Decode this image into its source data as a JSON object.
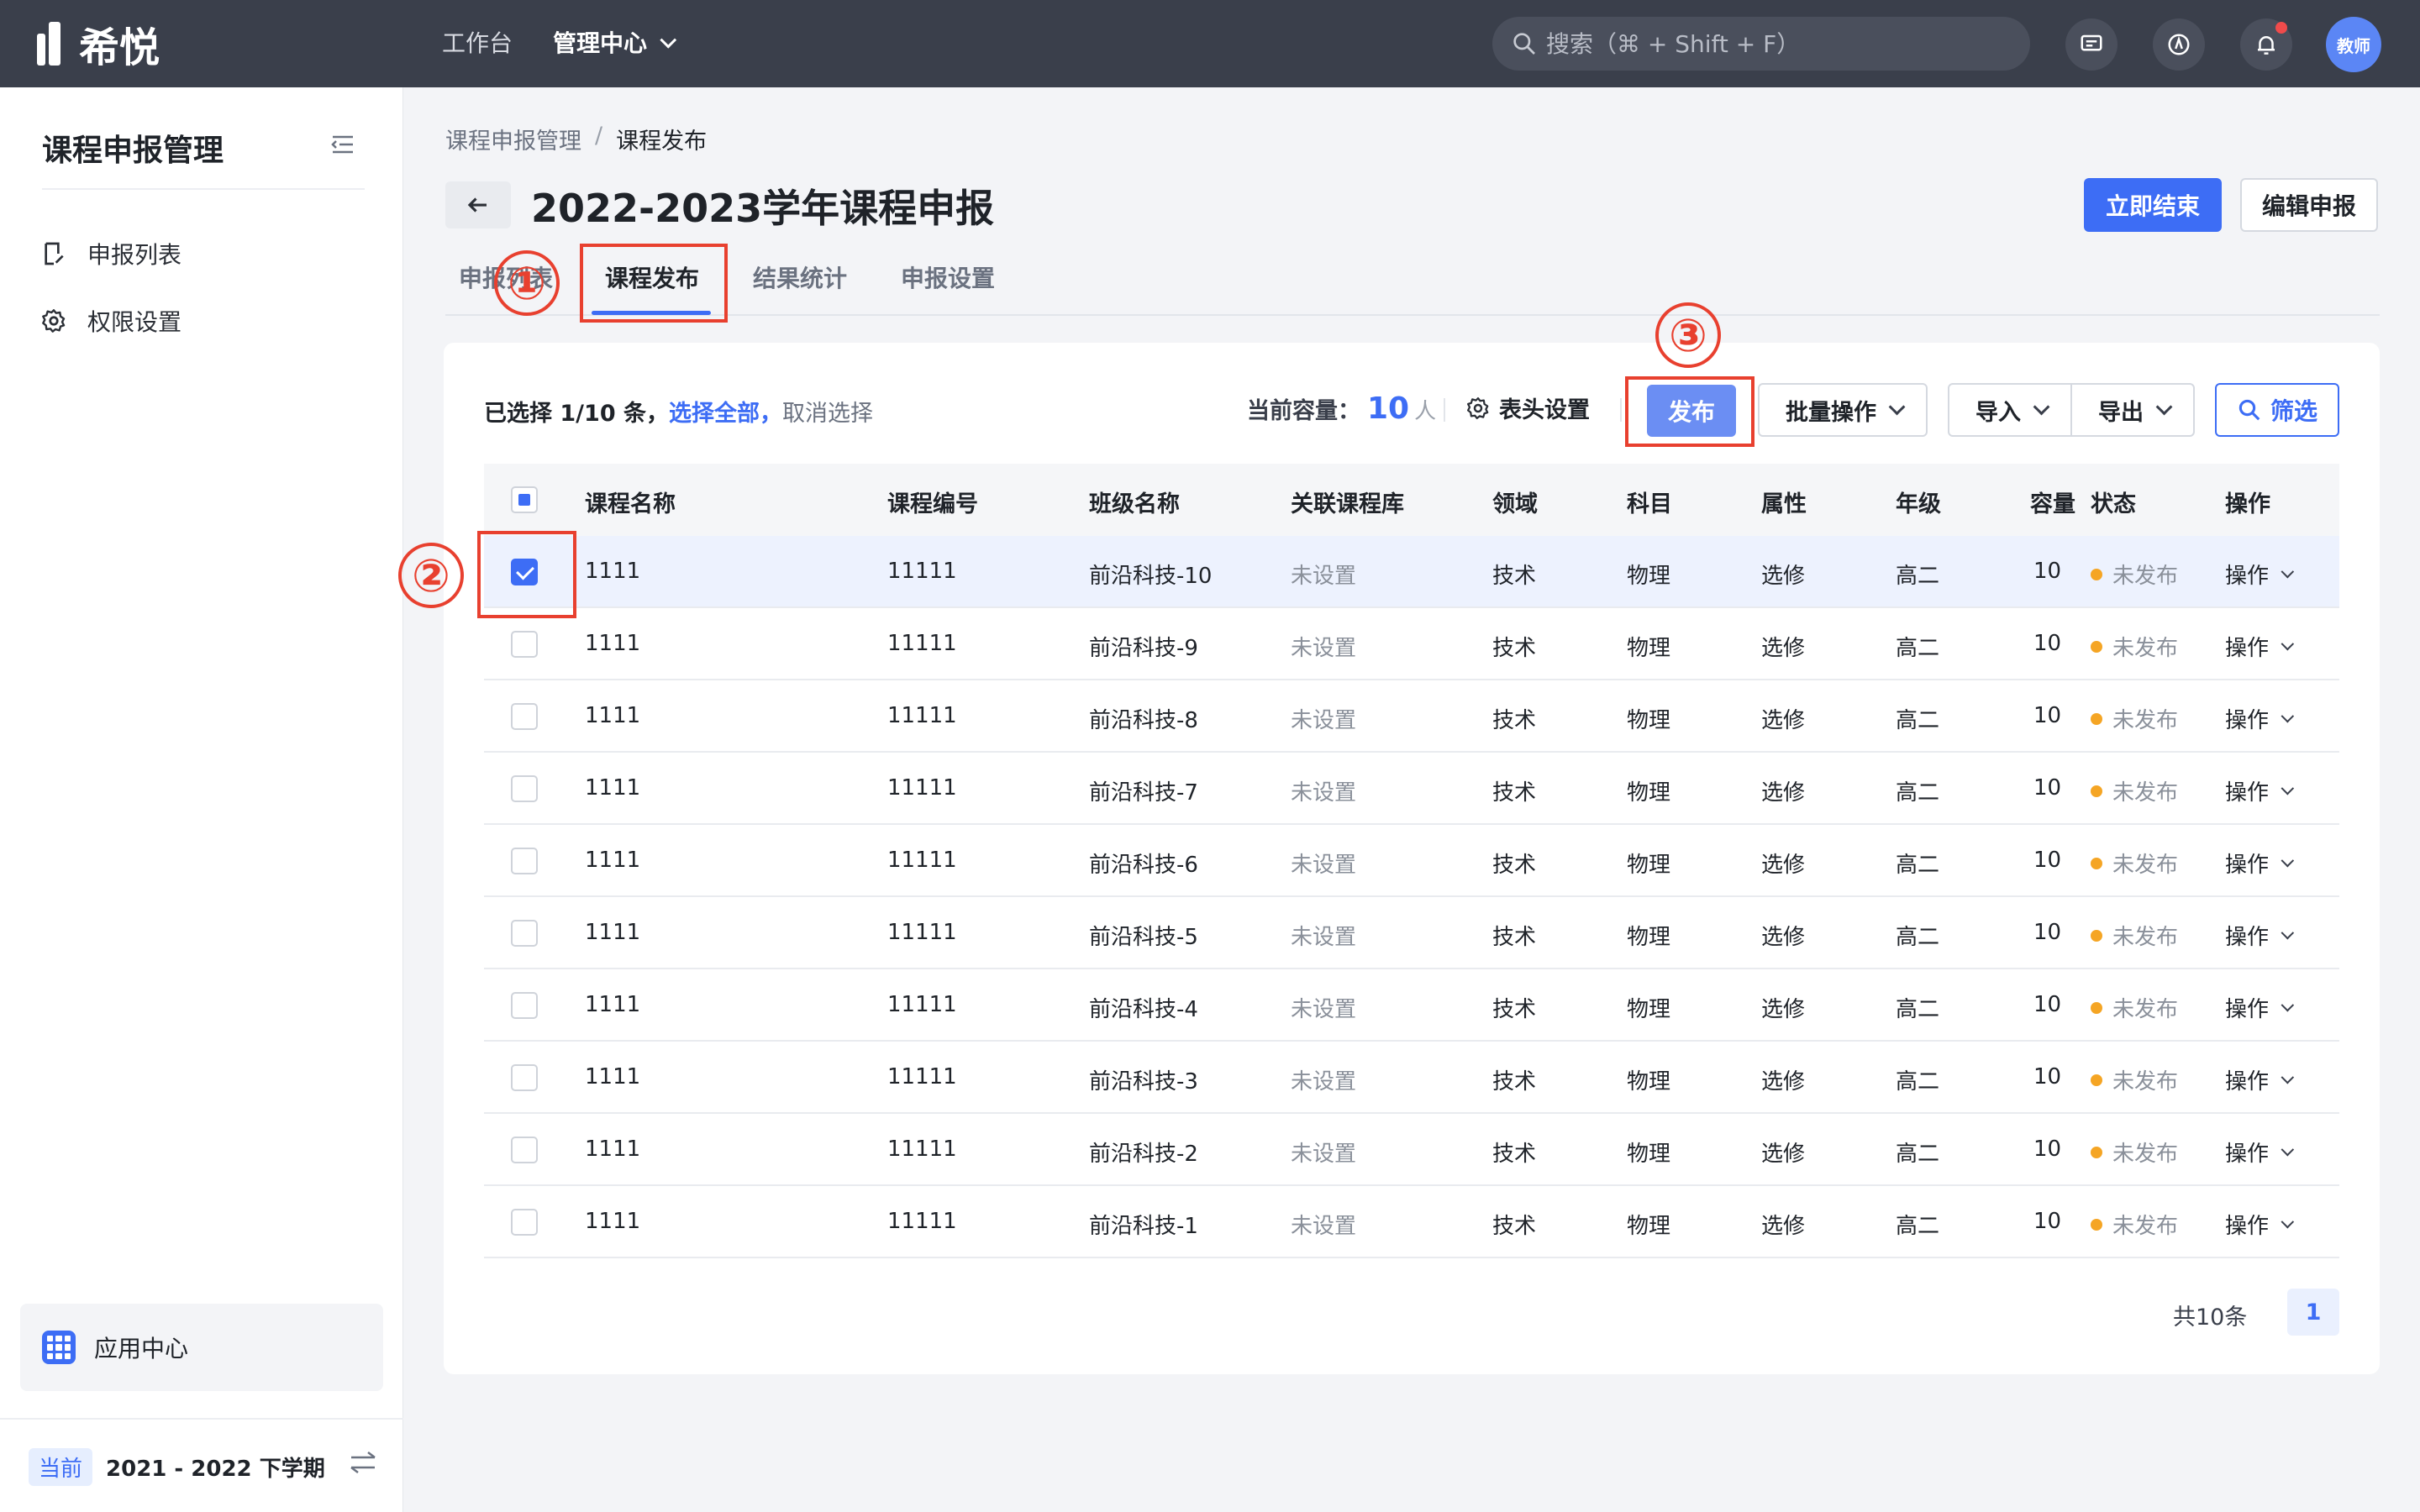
{
  "topbar": {
    "logo_text": "希悦",
    "nav": [
      {
        "label": "工作台"
      },
      {
        "label": "管理中心"
      }
    ],
    "search_placeholder": "搜索（⌘ + Shift + F）",
    "avatar_text": "教师"
  },
  "sidebar": {
    "title": "课程申报管理",
    "items": [
      {
        "label": "申报列表"
      },
      {
        "label": "权限设置"
      }
    ],
    "app_center": "应用中心",
    "term_tag": "当前",
    "term_label": "2021 - 2022 下学期"
  },
  "main": {
    "breadcrumb": [
      "课程申报管理",
      "/",
      "课程发布"
    ],
    "title": "2022-2023学年课程申报",
    "end_now": "立即结束",
    "edit": "编辑申报",
    "tabs": [
      {
        "label": "申报列表"
      },
      {
        "label": "课程发布"
      },
      {
        "label": "结果统计"
      },
      {
        "label": "申报设置"
      }
    ],
    "selection": {
      "prefix": "已选择 1/10 条，",
      "select_all": "选择全部，",
      "cancel": "取消选择"
    },
    "capacity": {
      "label": "当前容量：",
      "value": "10",
      "unit": "人"
    },
    "header_settings": "表头设置",
    "publish": "发布",
    "batch": "批量操作",
    "import": "导入",
    "export": "导出",
    "filter": "筛选",
    "columns": [
      "课程名称",
      "课程编号",
      "班级名称",
      "关联课程库",
      "领域",
      "科目",
      "属性",
      "年级",
      "容量",
      "状态",
      "操作"
    ],
    "rows": [
      {
        "name": "1111",
        "code": "11111",
        "class": "前沿科技-10",
        "lib": "未设置",
        "field": "技术",
        "subject": "物理",
        "attr": "选修",
        "grade": "高二",
        "cap": "10",
        "status": "未发布",
        "op": "操作",
        "checked": true
      },
      {
        "name": "1111",
        "code": "11111",
        "class": "前沿科技-9",
        "lib": "未设置",
        "field": "技术",
        "subject": "物理",
        "attr": "选修",
        "grade": "高二",
        "cap": "10",
        "status": "未发布",
        "op": "操作",
        "checked": false
      },
      {
        "name": "1111",
        "code": "11111",
        "class": "前沿科技-8",
        "lib": "未设置",
        "field": "技术",
        "subject": "物理",
        "attr": "选修",
        "grade": "高二",
        "cap": "10",
        "status": "未发布",
        "op": "操作",
        "checked": false
      },
      {
        "name": "1111",
        "code": "11111",
        "class": "前沿科技-7",
        "lib": "未设置",
        "field": "技术",
        "subject": "物理",
        "attr": "选修",
        "grade": "高二",
        "cap": "10",
        "status": "未发布",
        "op": "操作",
        "checked": false
      },
      {
        "name": "1111",
        "code": "11111",
        "class": "前沿科技-6",
        "lib": "未设置",
        "field": "技术",
        "subject": "物理",
        "attr": "选修",
        "grade": "高二",
        "cap": "10",
        "status": "未发布",
        "op": "操作",
        "checked": false
      },
      {
        "name": "1111",
        "code": "11111",
        "class": "前沿科技-5",
        "lib": "未设置",
        "field": "技术",
        "subject": "物理",
        "attr": "选修",
        "grade": "高二",
        "cap": "10",
        "status": "未发布",
        "op": "操作",
        "checked": false
      },
      {
        "name": "1111",
        "code": "11111",
        "class": "前沿科技-4",
        "lib": "未设置",
        "field": "技术",
        "subject": "物理",
        "attr": "选修",
        "grade": "高二",
        "cap": "10",
        "status": "未发布",
        "op": "操作",
        "checked": false
      },
      {
        "name": "1111",
        "code": "11111",
        "class": "前沿科技-3",
        "lib": "未设置",
        "field": "技术",
        "subject": "物理",
        "attr": "选修",
        "grade": "高二",
        "cap": "10",
        "status": "未发布",
        "op": "操作",
        "checked": false
      },
      {
        "name": "1111",
        "code": "11111",
        "class": "前沿科技-2",
        "lib": "未设置",
        "field": "技术",
        "subject": "物理",
        "attr": "选修",
        "grade": "高二",
        "cap": "10",
        "status": "未发布",
        "op": "操作",
        "checked": false
      },
      {
        "name": "1111",
        "code": "11111",
        "class": "前沿科技-1",
        "lib": "未设置",
        "field": "技术",
        "subject": "物理",
        "attr": "选修",
        "grade": "高二",
        "cap": "10",
        "status": "未发布",
        "op": "操作",
        "checked": false
      }
    ],
    "total": "共10条",
    "page": "1"
  },
  "annotations": [
    "①",
    "②",
    "③"
  ],
  "colors": {
    "topbar": "#3a3f4b",
    "accent": "#3d6df5",
    "annotation": "#e8402f",
    "status_dot": "#f5a524"
  }
}
